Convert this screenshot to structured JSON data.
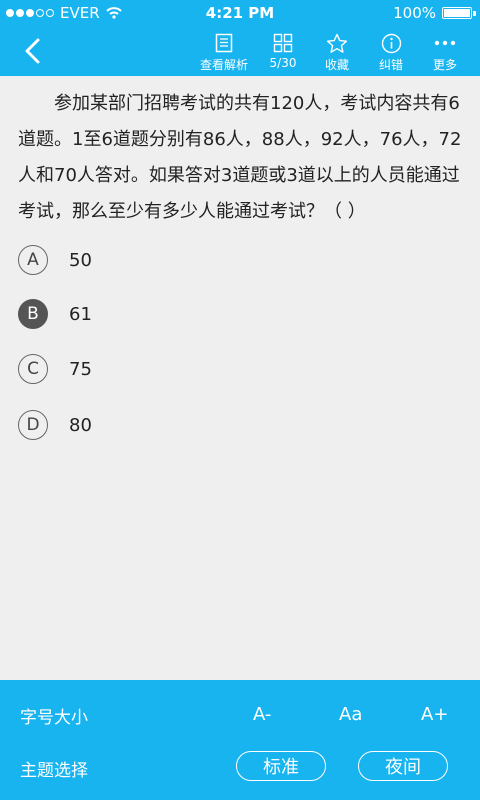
{
  "status": {
    "carrier": "EVER",
    "time": "4:21 PM",
    "battery": "100%"
  },
  "toolbar": {
    "back_icon": "chevron-left-icon",
    "items": [
      {
        "label": "查看解析",
        "icon": "document-icon"
      },
      {
        "label": "5/30",
        "icon": "grid-icon"
      },
      {
        "label": "收藏",
        "icon": "star-icon"
      },
      {
        "label": "纠错",
        "icon": "info-icon"
      },
      {
        "label": "更多",
        "icon": "more-icon"
      }
    ]
  },
  "question": {
    "text": "参加某部门招聘考试的共有120人，考试内容共有6道题。1至6道题分别有86人，88人，92人，76人，72人和70人答对。如果答对3道题或3道以上的人员能通过考试，那么至少有多少人能通过考试？（ ）"
  },
  "options": [
    {
      "letter": "A",
      "text": "50",
      "selected": false
    },
    {
      "letter": "B",
      "text": "61",
      "selected": true
    },
    {
      "letter": "C",
      "text": "75",
      "selected": false
    },
    {
      "letter": "D",
      "text": "80",
      "selected": false
    }
  ],
  "settings": {
    "font_label": "字号大小",
    "font_small": "A-",
    "font_default": "Aa",
    "font_large": "A+",
    "theme_label": "主题选择",
    "theme_standard": "标准",
    "theme_night": "夜间"
  },
  "colors": {
    "accent": "#18b4f0",
    "background": "#efefef",
    "selected": "#555555"
  }
}
